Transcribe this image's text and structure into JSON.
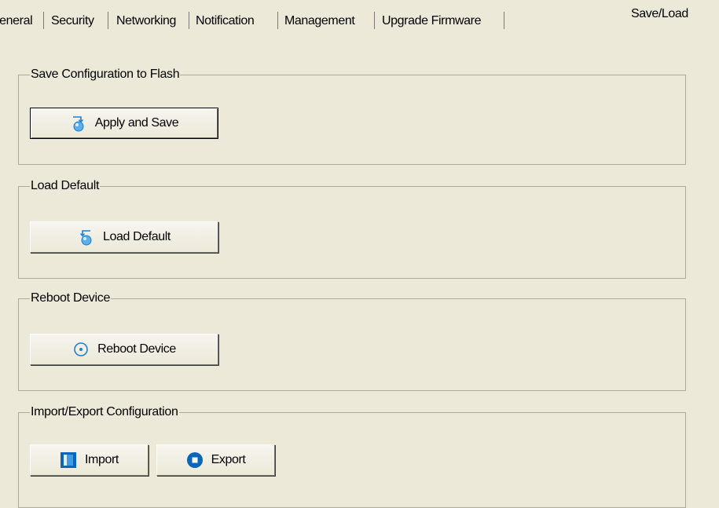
{
  "tabs": [
    {
      "label": "ieneral",
      "active": false
    },
    {
      "label": "Security",
      "active": false
    },
    {
      "label": "Networking",
      "active": false
    },
    {
      "label": "Notification",
      "active": false
    },
    {
      "label": "Management",
      "active": false
    },
    {
      "label": "Upgrade Firmware",
      "active": false
    },
    {
      "label": "Save/Load",
      "active": true
    }
  ],
  "groups": {
    "save": {
      "title": "Save Configuration to Flash",
      "button": "Apply and Save",
      "icon": "apply-save-icon"
    },
    "load_default": {
      "title": "Load Default",
      "button": "Load Default",
      "icon": "load-default-icon"
    },
    "reboot": {
      "title": "Reboot Device",
      "button": "Reboot Device",
      "icon": "reboot-icon"
    },
    "import_export": {
      "title": "Import/Export Configuration",
      "import_button": "Import",
      "export_button": "Export",
      "import_icon": "import-icon",
      "export_icon": "export-icon"
    }
  },
  "colors": {
    "background": "#ECE9D8",
    "group_border": "#B0AB98",
    "icon_blue": "#1F7FD1"
  }
}
